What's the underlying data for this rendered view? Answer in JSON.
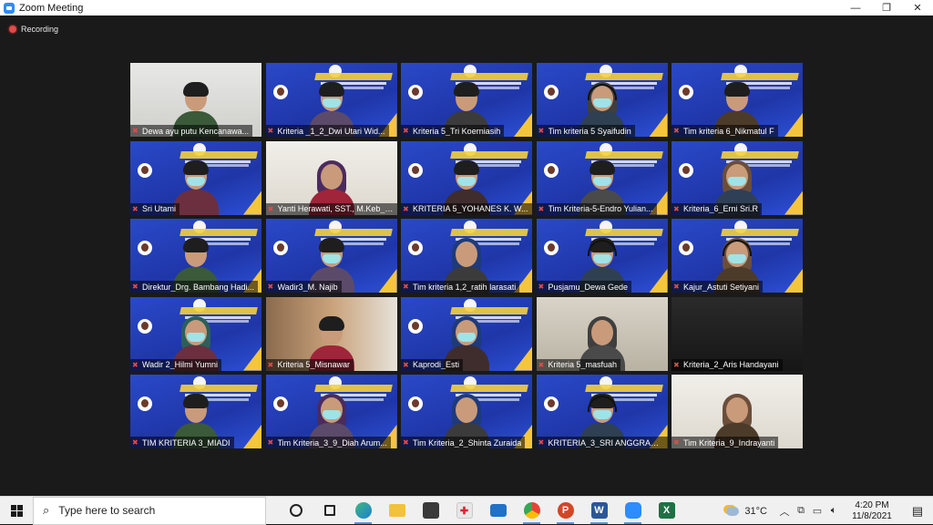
{
  "window": {
    "title": "Zoom Meeting",
    "minimize": "—",
    "restore": "❐",
    "close": "✕"
  },
  "recording": {
    "label": "Recording",
    "color": "#e24b4b"
  },
  "tiles": [
    {
      "name": "Dewa ayu putu Kencanawa...",
      "bg": "room"
    },
    {
      "name": "Kriteria _1_2_Dwi Utari Wid...",
      "bg": "slide"
    },
    {
      "name": "Kriteria 5_Tri Koerniasih",
      "bg": "slide"
    },
    {
      "name": "Tim kriteria 5 Syaifudin",
      "bg": "slide"
    },
    {
      "name": "Tim kriteria 6_Nikmatul F",
      "bg": "slide"
    },
    {
      "name": "Sri Utami",
      "bg": "slide"
    },
    {
      "name": "Yanti Herawati, SST., M.Keb_A...",
      "bg": "room",
      "active": true
    },
    {
      "name": "KRITERIA 5_YOHANES K. W...",
      "bg": "slide"
    },
    {
      "name": "Tim Kriteria-5-Endro Yulian...",
      "bg": "slide"
    },
    {
      "name": "Kriteria_6_Erni Sri.R",
      "bg": "slide"
    },
    {
      "name": "Direktur_Drg. Bambang Hadi...",
      "bg": "slide"
    },
    {
      "name": "Wadir3_M. Najib",
      "bg": "slide"
    },
    {
      "name": "Tim kriteria 1,2_ratih larasati",
      "bg": "slide"
    },
    {
      "name": "Pusjamu_Dewa Gede",
      "bg": "slide"
    },
    {
      "name": "Kajur_Astuti Setiyani",
      "bg": "slide"
    },
    {
      "name": "Wadir 2_Hilmi Yumni",
      "bg": "slide"
    },
    {
      "name": "Kriteria 5_Misnawar",
      "bg": "room"
    },
    {
      "name": "Kaprodi_Esti",
      "bg": "slide"
    },
    {
      "name": "Kriteria 5_masfuah",
      "bg": "room"
    },
    {
      "name": "Kriteria_2_Aris Handayani",
      "bg": "room"
    },
    {
      "name": "TIM KRITERIA 3_MIADI",
      "bg": "slide"
    },
    {
      "name": "Tim Kriteria_3_9_Diah Arum...",
      "bg": "slide"
    },
    {
      "name": "Tim Kriteria_2_Shinta Zuraida",
      "bg": "slide"
    },
    {
      "name": "KRITERIA_3_SRI ANGGRAENI",
      "bg": "slide"
    },
    {
      "name": "Tim Kriteria_9_Indrayanti",
      "bg": "room"
    }
  ],
  "taskbar": {
    "search_placeholder": "Type here to search",
    "apps": [
      "cortana-icon",
      "task-view-icon",
      "edge-icon",
      "file-explorer-icon",
      "store-icon",
      "gift-icon",
      "mail-icon",
      "chrome-icon",
      "powerpoint-icon",
      "word-icon",
      "zoom-icon",
      "excel-icon"
    ],
    "temperature": "31°C",
    "time": "4:20 PM",
    "date": "11/8/2021"
  }
}
